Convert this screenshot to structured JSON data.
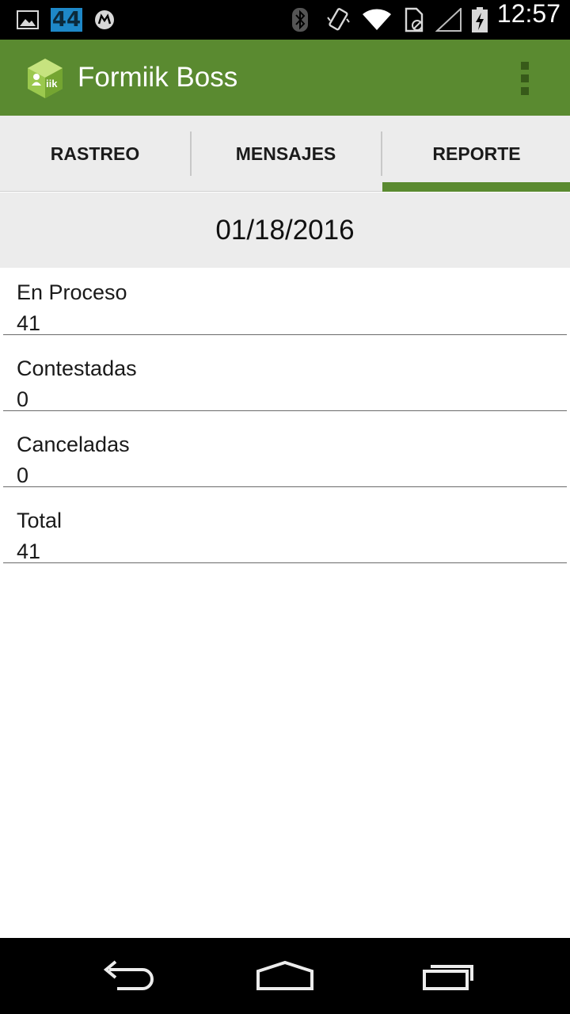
{
  "status_bar": {
    "badge": "44",
    "time": "12:57",
    "icons": [
      "gallery-icon",
      "badge-icon",
      "motorola-icon",
      "bluetooth-icon",
      "vibrate-icon",
      "wifi-icon",
      "sim-icon",
      "signal-icon",
      "battery-icon"
    ]
  },
  "action_bar": {
    "title": "Formiik Boss",
    "logo_text": "iik",
    "accent": "#5a8a30"
  },
  "tabs": [
    {
      "label": "RASTREO"
    },
    {
      "label": "MENSAJES"
    },
    {
      "label": "REPORTE",
      "selected": true
    }
  ],
  "report": {
    "date": "01/18/2016",
    "rows": [
      {
        "label": "En Proceso",
        "value": "41"
      },
      {
        "label": "Contestadas",
        "value": "0"
      },
      {
        "label": "Canceladas",
        "value": "0"
      },
      {
        "label": "Total",
        "value": "41"
      }
    ]
  }
}
